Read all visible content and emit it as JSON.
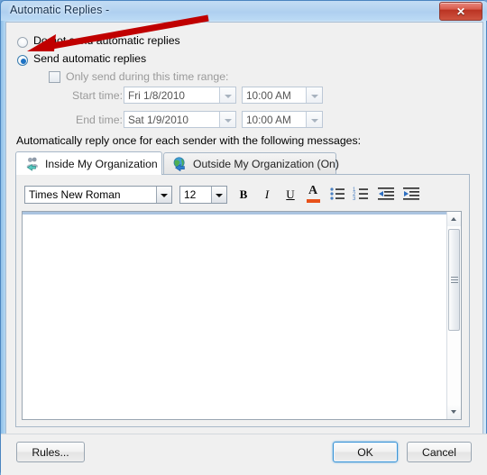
{
  "window": {
    "title": "Automatic Replies -",
    "close_icon": "close-icon",
    "close_glyph": "✕"
  },
  "options": {
    "do_not_send_label": "Do not send automatic replies",
    "send_label": "Send automatic replies",
    "selected": "send",
    "time_range_label": "Only send during this time range:",
    "time_range_checked": false,
    "start_time_label": "Start time:",
    "start_date_value": "Fri 1/8/2010",
    "start_clock_value": "10:00 AM",
    "end_time_label": "End time:",
    "end_date_value": "Sat 1/9/2010",
    "end_clock_value": "10:00 AM"
  },
  "messages": {
    "section_label": "Automatically reply once for each sender with the following messages:",
    "tabs": [
      {
        "label": "Inside My Organization",
        "icon": "people-arrow-icon",
        "active": true
      },
      {
        "label": "Outside My Organization (On)",
        "icon": "globe-arrow-icon",
        "active": false
      }
    ]
  },
  "toolbar": {
    "font_family_value": "Times New Roman",
    "font_size_value": "12",
    "buttons": [
      {
        "name": "bold-button",
        "glyph": "B"
      },
      {
        "name": "italic-button",
        "glyph": "I"
      },
      {
        "name": "underline-button",
        "glyph": "U"
      },
      {
        "name": "font-color-button",
        "glyph": "A"
      },
      {
        "name": "bullet-list-button",
        "glyph": "list"
      },
      {
        "name": "numbered-list-button",
        "glyph": "numlist"
      },
      {
        "name": "decrease-indent-button",
        "glyph": "outdent"
      },
      {
        "name": "increase-indent-button",
        "glyph": "indent"
      }
    ],
    "font_color_swatch": "#e8511a"
  },
  "editor": {
    "body_text": "",
    "scrollbar_up_glyph": "▲",
    "scrollbar_down_glyph": "▼"
  },
  "footer": {
    "rules_label": "Rules...",
    "ok_label": "OK",
    "cancel_label": "Cancel"
  },
  "annotation": {
    "arrow_color": "#c00000",
    "points_at": "send-automatic-replies-radio"
  },
  "colors": {
    "titlebar": "#b4d3f0",
    "dialog_bg": "#f0f0f0",
    "accent": "#1d72c4",
    "close_red": "#ba3322"
  }
}
